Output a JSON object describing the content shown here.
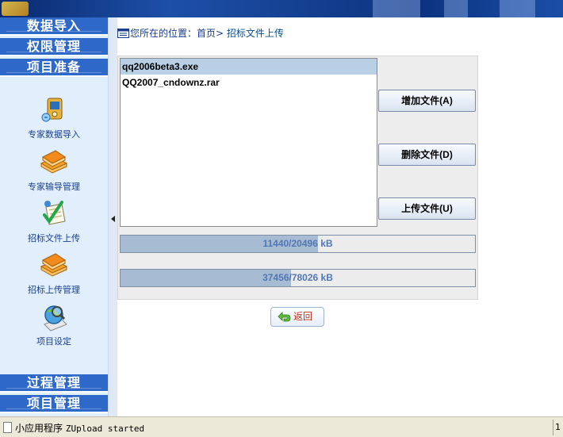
{
  "sidebar": {
    "menus_top": [
      {
        "label": "数据导入"
      },
      {
        "label": "权限管理"
      },
      {
        "label": "项目准备"
      }
    ],
    "items": [
      {
        "label": "专家数据导入",
        "icon": "media-player-icon"
      },
      {
        "label": "专家输导管理",
        "icon": "book-stack-icon"
      },
      {
        "label": "招标文件上传",
        "icon": "upload-checklist-icon"
      },
      {
        "label": "招标上传管理",
        "icon": "book-stack-icon"
      },
      {
        "label": "项目设定",
        "icon": "globe-magnifier-icon"
      }
    ],
    "menus_bottom": [
      {
        "label": "过程管理"
      },
      {
        "label": "项目管理"
      }
    ]
  },
  "breadcrumb": {
    "prefix": "您所在的位置：",
    "home": "首页",
    "separator": ">",
    "current": "招标文件上传"
  },
  "applet": {
    "files": [
      {
        "name": "qq2006beta3.exe",
        "selected": true
      },
      {
        "name": "QQ2007_cndownz.rar",
        "selected": false
      }
    ],
    "buttons": {
      "add": "增加文件(A)",
      "delete": "删除文件(D)",
      "upload": "上传文件(U)"
    },
    "progress": [
      {
        "text": "11440/20496 kB",
        "fraction": 0.558
      },
      {
        "text": "37456/78026 kB",
        "fraction": 0.48
      }
    ]
  },
  "back_label": "返回",
  "status": {
    "label": "小应用程序",
    "message": "ZUpload started",
    "right_fragment": "1"
  },
  "colors": {
    "menu_blue": "#2e69c9",
    "sidebar_bg": "#e1eefb",
    "progress_fill": "#a7bbd2",
    "selection": "#b8cfe5"
  }
}
